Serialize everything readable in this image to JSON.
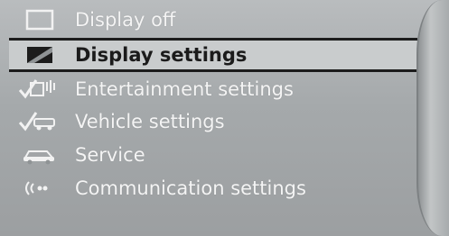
{
  "menu": {
    "items": [
      {
        "label": "Display off",
        "icon": "display-off-icon",
        "selected": false
      },
      {
        "label": "Display settings",
        "icon": "display-settings-icon",
        "selected": true
      },
      {
        "label": "Entertainment settings",
        "icon": "entertainment-settings-icon",
        "selected": false
      },
      {
        "label": "Vehicle settings",
        "icon": "vehicle-settings-icon",
        "selected": false
      },
      {
        "label": "Service",
        "icon": "service-car-icon",
        "selected": false
      },
      {
        "label": "Communication settings",
        "icon": "communication-settings-icon",
        "selected": false
      }
    ]
  },
  "colors": {
    "background": "#a9adaf",
    "text": "#f4f4f4",
    "selected_text": "#1b1b1b",
    "selected_border": "#1c1c1c"
  }
}
